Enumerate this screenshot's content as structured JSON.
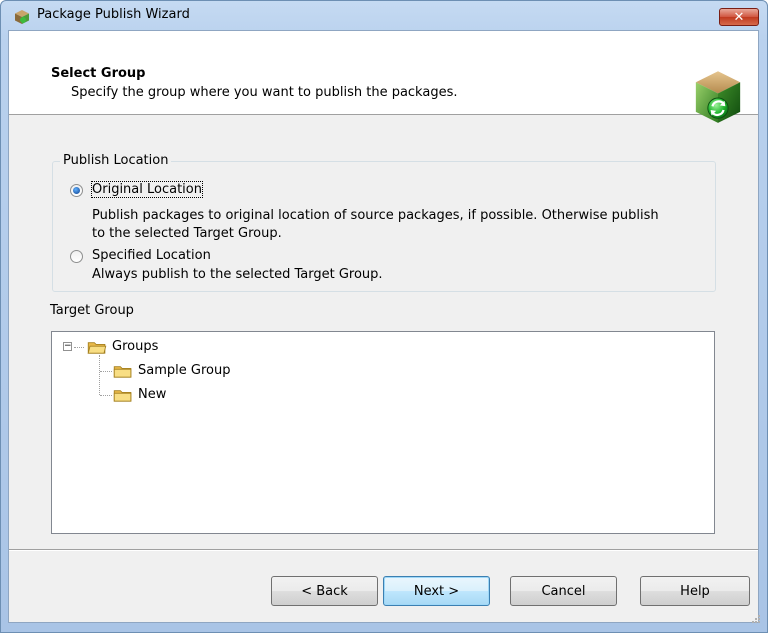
{
  "window": {
    "title": "Package Publish Wizard",
    "close_glyph": "✕",
    "title_icon": "package-icon",
    "close_color": "#c0391f"
  },
  "header": {
    "title": "Select Group",
    "subtitle": "Specify the group where you want to publish the packages.",
    "logo_icon": "package-refresh-icon"
  },
  "publish_location": {
    "legend": "Publish Location",
    "options": [
      {
        "label": "Original Location",
        "checked": true,
        "description_lines": [
          "Publish packages to original location of source packages, if possible. Otherwise publish",
          "to the selected Target Group."
        ]
      },
      {
        "label": "Specified Location",
        "checked": false,
        "description_lines": [
          "Always publish to the selected Target Group."
        ]
      }
    ]
  },
  "target_group": {
    "label": "Target Group",
    "tree": {
      "root": {
        "label": "Groups",
        "expanded": true,
        "expander_glyph": "−"
      },
      "children": [
        {
          "label": "Sample Group"
        },
        {
          "label": "New"
        }
      ]
    }
  },
  "buttons": {
    "back": "< Back",
    "next": "Next >",
    "cancel": "Cancel",
    "help": "Help"
  },
  "colors": {
    "accent": "#3c7fb1",
    "folder": "#f3d36f"
  }
}
